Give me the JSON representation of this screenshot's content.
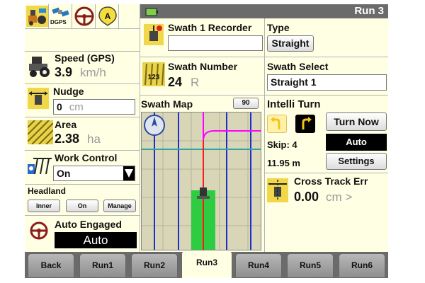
{
  "header": {
    "title": "Run 3",
    "status_icons": [
      "tractor-camera-icon",
      "dgps-satellite-icon",
      "steering-wheel-icon",
      "auto-guidance-icon"
    ],
    "dgps_label": "DGPS"
  },
  "speed": {
    "label": "Speed (GPS)",
    "value": "3.9",
    "unit": "km/h"
  },
  "nudge": {
    "label": "Nudge",
    "value": "0",
    "unit": "cm"
  },
  "area": {
    "label": "Area",
    "value": "2.38",
    "unit": "ha"
  },
  "work_control": {
    "label": "Work Control",
    "value": "On"
  },
  "headland": {
    "label": "Headland",
    "buttons": [
      "Inner",
      "On",
      "Manage"
    ]
  },
  "auto_engaged": {
    "label": "Auto Engaged",
    "value": "Auto"
  },
  "swath_recorder": {
    "label": "Swath 1 Recorder",
    "value": ""
  },
  "type": {
    "label": "Type",
    "value": "Straight"
  },
  "swath_number": {
    "label": "Swath Number",
    "value": "24",
    "side": "R"
  },
  "swath_select": {
    "label": "Swath Select",
    "value": "Straight 1"
  },
  "swath_map": {
    "label": "Swath Map",
    "zoom": "90"
  },
  "intelli_turn": {
    "label": "Intelli Turn",
    "turn_now": "Turn Now",
    "mode": "Auto",
    "settings": "Settings",
    "skip": "Skip: 4",
    "distance": "11.95 m"
  },
  "cross_track": {
    "label": "Cross Track Err",
    "value": "0.00",
    "unit": "cm >"
  },
  "tabs": [
    "Back",
    "Run1",
    "Run2",
    "Run3",
    "Run4",
    "Run5",
    "Run6"
  ],
  "active_tab": "Run3",
  "colors": {
    "panel_bg": "#ffffe4",
    "header_bg": "#6b6b6b",
    "active_black": "#000000",
    "swath_green": "#2ecc40",
    "map_blue": "#1d2fc9",
    "map_red": "#ff1a1a",
    "map_magenta": "#ff00ff",
    "map_teal": "#2aa6a6"
  }
}
